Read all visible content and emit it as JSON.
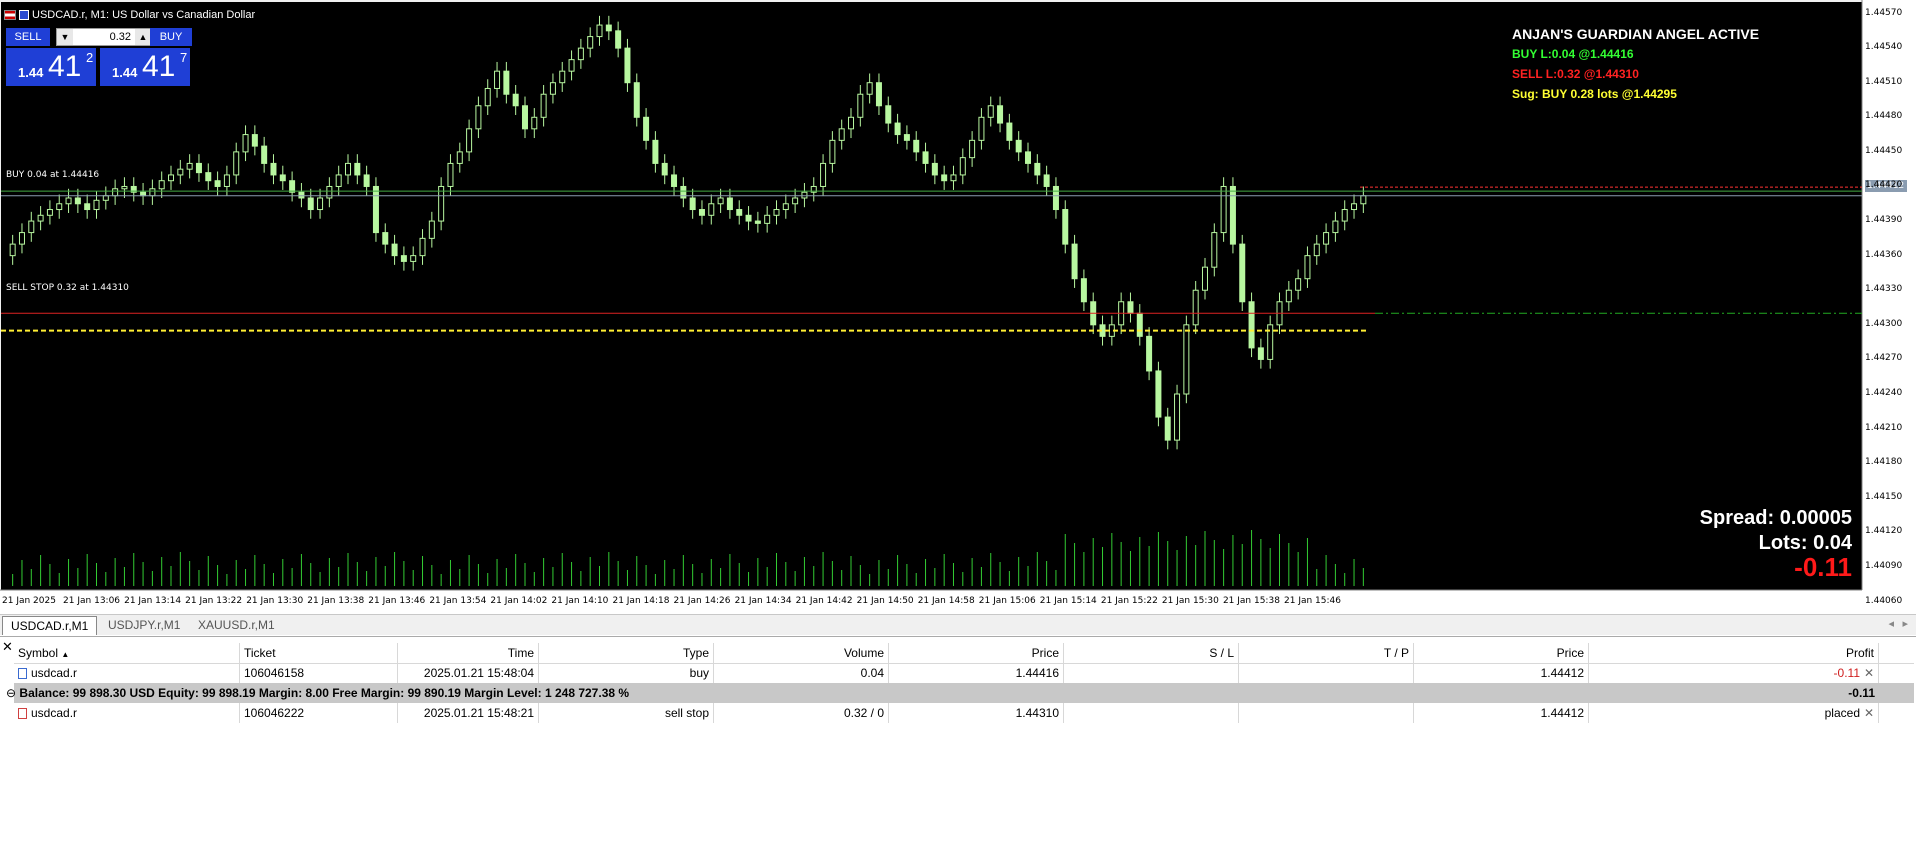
{
  "window": {
    "title": "USDCAD.r, M1:  US Dollar vs Canadian Dollar"
  },
  "trade_panel": {
    "sell_label": "SELL",
    "buy_label": "BUY",
    "lot_value": "0.32",
    "sell_price_prefix": "1.44",
    "sell_price_big": "41",
    "sell_price_sup": "2",
    "buy_price_prefix": "1.44",
    "buy_price_big": "41",
    "buy_price_sup": "7"
  },
  "indicator_overlay": {
    "heading": "ANJAN'S GUARDIAN ANGEL ACTIVE",
    "buy_line": "BUY  L:0.04 @1.44416",
    "sell_line": "SELL  L:0.32 @1.44310",
    "suggestion_line": "Sug: BUY 0.28 lots @1.44295",
    "spread": "Spread: 0.00005",
    "lots": "Lots: 0.04",
    "profit": "-0.11"
  },
  "chart_labels": {
    "buy_order_label": "BUY 0.04 at 1.44416",
    "sell_stop_label": "SELL STOP 0.32 at 1.44310",
    "current_price_tag": "1.44412"
  },
  "colors": {
    "chart_bg": "#000000",
    "candle": "#b8f7a0",
    "volume": "#33cc33",
    "buy_line": "#44aa44",
    "sell_line": "#dd2222",
    "suggest_line": "#ffee33",
    "heading": "#ffffff",
    "buy_text": "#33ff33",
    "sell_text": "#ff2222",
    "sug_text": "#ffff33",
    "button_blue": "#1f3fd6"
  },
  "chart_data": {
    "type": "candlestick",
    "symbol": "USDCAD.r",
    "timeframe": "M1",
    "ylim": [
      1.4407,
      1.4458
    ],
    "y_ticks": [
      "1.44570",
      "1.44540",
      "1.44510",
      "1.44480",
      "1.44450",
      "1.44420",
      "1.44390",
      "1.44360",
      "1.44330",
      "1.44300",
      "1.44270",
      "1.44240",
      "1.44210",
      "1.44180",
      "1.44150",
      "1.44120",
      "1.44090",
      "1.44060"
    ],
    "x_ticks": [
      "21 Jan 2025",
      "21 Jan 13:06",
      "21 Jan 13:14",
      "21 Jan 13:22",
      "21 Jan 13:30",
      "21 Jan 13:38",
      "21 Jan 13:46",
      "21 Jan 13:54",
      "21 Jan 14:02",
      "21 Jan 14:10",
      "21 Jan 14:18",
      "21 Jan 14:26",
      "21 Jan 14:34",
      "21 Jan 14:42",
      "21 Jan 14:50",
      "21 Jan 14:58",
      "21 Jan 15:06",
      "21 Jan 15:14",
      "21 Jan 15:22",
      "21 Jan 15:30",
      "21 Jan 15:38",
      "21 Jan 15:46"
    ],
    "closes": [
      1.4437,
      1.4438,
      1.4439,
      1.44395,
      1.444,
      1.44405,
      1.4441,
      1.44405,
      1.444,
      1.44408,
      1.44412,
      1.44418,
      1.4442,
      1.44415,
      1.44412,
      1.44418,
      1.44425,
      1.4443,
      1.44435,
      1.4444,
      1.44432,
      1.44425,
      1.4442,
      1.4443,
      1.4445,
      1.44465,
      1.44455,
      1.4444,
      1.4443,
      1.44425,
      1.44415,
      1.4441,
      1.444,
      1.4441,
      1.4442,
      1.4443,
      1.4444,
      1.4443,
      1.4442,
      1.4438,
      1.4437,
      1.4436,
      1.44355,
      1.4436,
      1.44375,
      1.4439,
      1.4442,
      1.4444,
      1.4445,
      1.4447,
      1.4449,
      1.44505,
      1.4452,
      1.445,
      1.4449,
      1.4447,
      1.4448,
      1.445,
      1.4451,
      1.4452,
      1.4453,
      1.4454,
      1.4455,
      1.4456,
      1.44555,
      1.4454,
      1.4451,
      1.4448,
      1.4446,
      1.4444,
      1.4443,
      1.4442,
      1.4441,
      1.444,
      1.44395,
      1.44405,
      1.4441,
      1.444,
      1.44395,
      1.4439,
      1.44388,
      1.44395,
      1.444,
      1.44405,
      1.4441,
      1.44415,
      1.4442,
      1.4444,
      1.4446,
      1.4447,
      1.4448,
      1.445,
      1.4451,
      1.4449,
      1.44475,
      1.44465,
      1.4446,
      1.4445,
      1.4444,
      1.4443,
      1.44425,
      1.4443,
      1.44445,
      1.4446,
      1.4448,
      1.4449,
      1.44475,
      1.4446,
      1.4445,
      1.4444,
      1.4443,
      1.4442,
      1.444,
      1.4437,
      1.4434,
      1.4432,
      1.443,
      1.4429,
      1.443,
      1.4432,
      1.4431,
      1.4429,
      1.4426,
      1.4422,
      1.442,
      1.4424,
      1.443,
      1.4433,
      1.4435,
      1.4438,
      1.4442,
      1.4437,
      1.4432,
      1.4428,
      1.4427,
      1.443,
      1.4432,
      1.4433,
      1.4434,
      1.4436,
      1.4437,
      1.4438,
      1.4439,
      1.444,
      1.44405,
      1.44412
    ]
  },
  "tabs": [
    {
      "label": "USDCAD.r,M1"
    },
    {
      "label": "USDJPY.r,M1"
    },
    {
      "label": "XAUUSD.r,M1"
    }
  ],
  "terminal": {
    "headers": [
      "Symbol",
      "Ticket",
      "Time",
      "Type",
      "Volume",
      "Price",
      "S / L",
      "T / P",
      "Price",
      "Profit"
    ],
    "rows": [
      {
        "symbol": "usdcad.r",
        "ticket": "106046158",
        "time": "2025.01.21 15:48:04",
        "type": "buy",
        "volume": "0.04",
        "price": "1.44416",
        "sl": "",
        "tp": "",
        "cur_price": "1.44412",
        "profit": "-0.11"
      },
      {
        "symbol": "usdcad.r",
        "ticket": "106046222",
        "time": "2025.01.21 15:48:21",
        "type": "sell stop",
        "volume": "0.32 / 0",
        "price": "1.44310",
        "sl": "",
        "tp": "",
        "cur_price": "1.44412",
        "profit": "placed"
      }
    ],
    "balance_line": "Balance: 99 898.30 USD  Equity: 99 898.19  Margin: 8.00  Free Margin: 99 890.19  Margin Level: 1 248 727.38 %",
    "balance_profit": "-0.11"
  }
}
